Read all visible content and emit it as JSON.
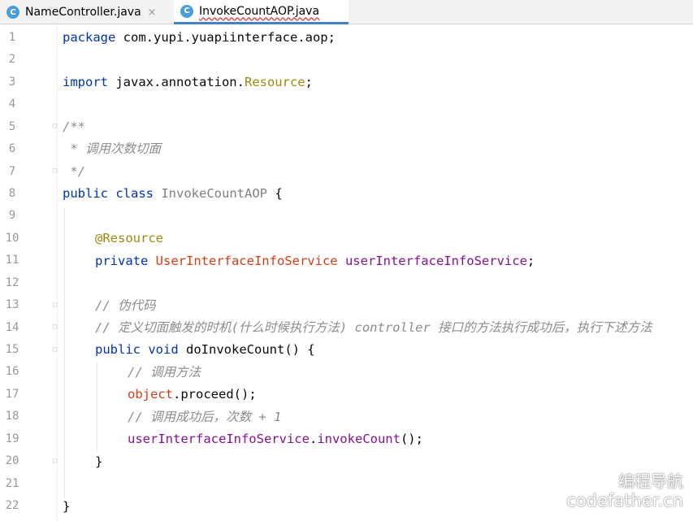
{
  "tabs": [
    {
      "icon": "C",
      "label": "NameController.java",
      "close": "×"
    },
    {
      "icon": "C",
      "label": "InvokeCountAOP.java"
    }
  ],
  "lines": {
    "l1": {
      "kw": "package",
      "rest": " com.yupi.yuapiinterface.aop;"
    },
    "l3": {
      "kw": "import",
      "pre": " javax.annotation.",
      "res": "Resource",
      "end": ";"
    },
    "l5": {
      "cmt": "/**"
    },
    "l6": {
      "cmt": " * 调用次数切面"
    },
    "l7": {
      "cmt": " */"
    },
    "l8": {
      "kw1": "public",
      "kw2": " class",
      "cls": " InvokeCountAOP",
      "rest": " {"
    },
    "l10": {
      "ann": "@Resource"
    },
    "l11": {
      "kw": "private",
      "type": " UserInterfaceInfoService",
      "field": " userInterfaceInfoService",
      "end": ";"
    },
    "l13": {
      "cmt": "// 伪代码"
    },
    "l14": {
      "cmt": "// 定义切面触发的时机(什么时候执行方法) controller 接口的方法执行成功后，执行下述方法"
    },
    "l15": {
      "kw1": "public",
      "kw2": " void",
      "rest": " doInvokeCount() {"
    },
    "l16": {
      "cmt": "// 调用方法"
    },
    "l17": {
      "obj": "object",
      "rest": ".proceed();"
    },
    "l18": {
      "cmt": "// 调用成功后，次数 + 1"
    },
    "l19": {
      "field": "userInterfaceInfoService",
      "dot": ".",
      "method": "invokeCount",
      "end": "();"
    },
    "l20": {
      "rest": "}"
    },
    "l22": {
      "rest": "}"
    }
  },
  "line_numbers": [
    "1",
    "2",
    "3",
    "4",
    "5",
    "6",
    "7",
    "8",
    "9",
    "10",
    "11",
    "12",
    "13",
    "14",
    "15",
    "16",
    "17",
    "18",
    "19",
    "20",
    "21",
    "22"
  ],
  "watermark": {
    "line1": "编程导航",
    "line2": "codefather.cn"
  }
}
